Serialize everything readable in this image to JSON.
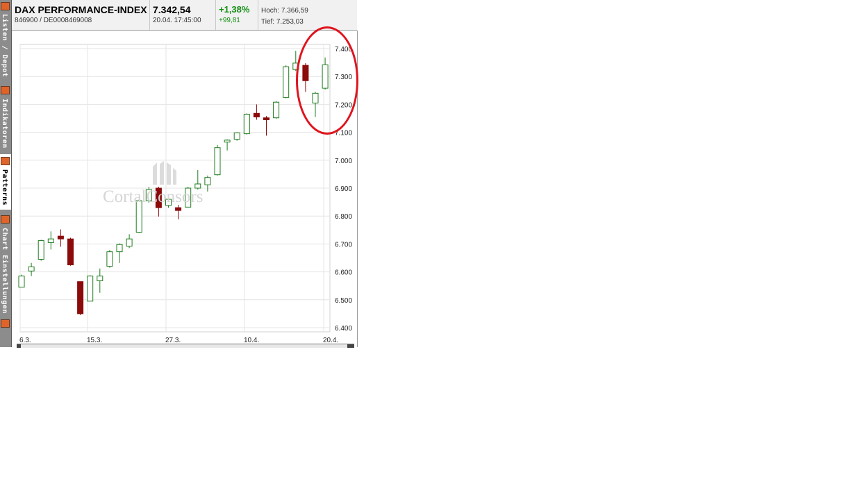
{
  "sidebar": {
    "tabs": [
      {
        "label": "Listen / Depot",
        "icon": "list-icon"
      },
      {
        "label": "Indikatoren",
        "icon": "indicator-icon"
      },
      {
        "label": "Patterns",
        "icon": "pattern-icon",
        "active": true
      },
      {
        "label": "Chart Einstellungen",
        "icon": "settings-icon"
      }
    ],
    "bottom_icon": "search-icon"
  },
  "header": {
    "name": "DAX PERFORMANCE-INDEX",
    "ids": "846900  /  DE0008469008",
    "price": "7.342,54",
    "timestamp": "20.04. 17:45:00",
    "change_pct": "+1,38%",
    "change_abs": "+99,81",
    "high": "Hoch: 7.366,59",
    "low": "Tief: 7.253,03",
    "positive_color": "#119011"
  },
  "watermark": "CortalConsors",
  "colors": {
    "up_body": "#ffffff",
    "up_stroke": "#1e7b1e",
    "down_body": "#8b0a0a",
    "highlight": "#e0141e",
    "grid": "#e4e4e4"
  },
  "chart_data": {
    "type": "candlestick",
    "x_tick_labels": [
      "6.3.",
      "15.3.",
      "27.3.",
      "10.4.",
      "20.4."
    ],
    "y_tick_labels": [
      "7.400",
      "7.300",
      "7.200",
      "7.100",
      "7.000",
      "6.900",
      "6.800",
      "6.700",
      "6.600",
      "6.500",
      "6.400"
    ],
    "ylim": [
      6400,
      7400
    ],
    "y_axis_side": "right",
    "grid": true,
    "candles": [
      {
        "open": 6545,
        "high": 6590,
        "low": 6545,
        "close": 6585
      },
      {
        "open": 6603,
        "high": 6632,
        "low": 6585,
        "close": 6618
      },
      {
        "open": 6645,
        "high": 6715,
        "low": 6640,
        "close": 6712
      },
      {
        "open": 6705,
        "high": 6745,
        "low": 6680,
        "close": 6718
      },
      {
        "open": 6728,
        "high": 6752,
        "low": 6690,
        "close": 6718
      },
      {
        "open": 6718,
        "high": 6722,
        "low": 6622,
        "close": 6625
      },
      {
        "open": 6565,
        "high": 6565,
        "low": 6445,
        "close": 6450
      },
      {
        "open": 6495,
        "high": 6588,
        "low": 6495,
        "close": 6585
      },
      {
        "open": 6568,
        "high": 6612,
        "low": 6525,
        "close": 6585
      },
      {
        "open": 6620,
        "high": 6678,
        "low": 6615,
        "close": 6672
      },
      {
        "open": 6672,
        "high": 6702,
        "low": 6632,
        "close": 6698
      },
      {
        "open": 6692,
        "high": 6735,
        "low": 6685,
        "close": 6718
      },
      {
        "open": 6742,
        "high": 6860,
        "low": 6740,
        "close": 6855
      },
      {
        "open": 6855,
        "high": 6905,
        "low": 6848,
        "close": 6895
      },
      {
        "open": 6900,
        "high": 6905,
        "low": 6798,
        "close": 6830
      },
      {
        "open": 6838,
        "high": 6872,
        "low": 6830,
        "close": 6860
      },
      {
        "open": 6830,
        "high": 6840,
        "low": 6788,
        "close": 6820
      },
      {
        "open": 6832,
        "high": 6905,
        "low": 6832,
        "close": 6900
      },
      {
        "open": 6900,
        "high": 6965,
        "low": 6895,
        "close": 6915
      },
      {
        "open": 6912,
        "high": 6945,
        "low": 6888,
        "close": 6938
      },
      {
        "open": 6948,
        "high": 7055,
        "low": 6945,
        "close": 7045
      },
      {
        "open": 7065,
        "high": 7075,
        "low": 7035,
        "close": 7072
      },
      {
        "open": 7075,
        "high": 7100,
        "low": 7070,
        "close": 7098
      },
      {
        "open": 7095,
        "high": 7168,
        "low": 7092,
        "close": 7165
      },
      {
        "open": 7168,
        "high": 7200,
        "low": 7145,
        "close": 7155
      },
      {
        "open": 7152,
        "high": 7158,
        "low": 7088,
        "close": 7145
      },
      {
        "open": 7152,
        "high": 7212,
        "low": 7148,
        "close": 7208
      },
      {
        "open": 7225,
        "high": 7340,
        "low": 7222,
        "close": 7335
      },
      {
        "open": 7325,
        "high": 7392,
        "low": 7320,
        "close": 7348
      },
      {
        "open": 7340,
        "high": 7348,
        "low": 7245,
        "close": 7285
      },
      {
        "open": 7205,
        "high": 7245,
        "low": 7155,
        "close": 7240
      },
      {
        "open": 7258,
        "high": 7368,
        "low": 7253,
        "close": 7342
      }
    ]
  }
}
